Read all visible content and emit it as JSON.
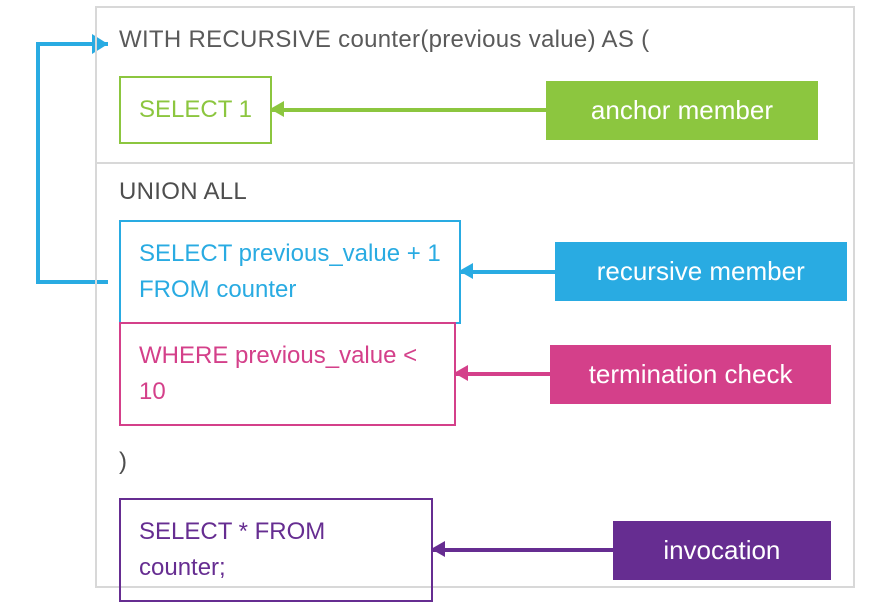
{
  "code": {
    "with_line": "WITH RECURSIVE counter(previous value) AS (",
    "select1": "SELECT 1",
    "union": "UNION ALL",
    "recursive_block": "SELECT previous_value + 1\nFROM counter",
    "where_block": "WHERE previous_value < 10",
    "close_paren": ")",
    "final_select": "SELECT * FROM counter;"
  },
  "labels": {
    "anchor": "anchor member",
    "recursive": "recursive member",
    "termination": "termination check",
    "invocation": "invocation"
  },
  "colors": {
    "green": "#8cc63f",
    "cyan": "#29abe2",
    "magenta": "#d4408a",
    "purple": "#662d91",
    "border": "#d8d8d8",
    "text": "#5a5a5a"
  }
}
